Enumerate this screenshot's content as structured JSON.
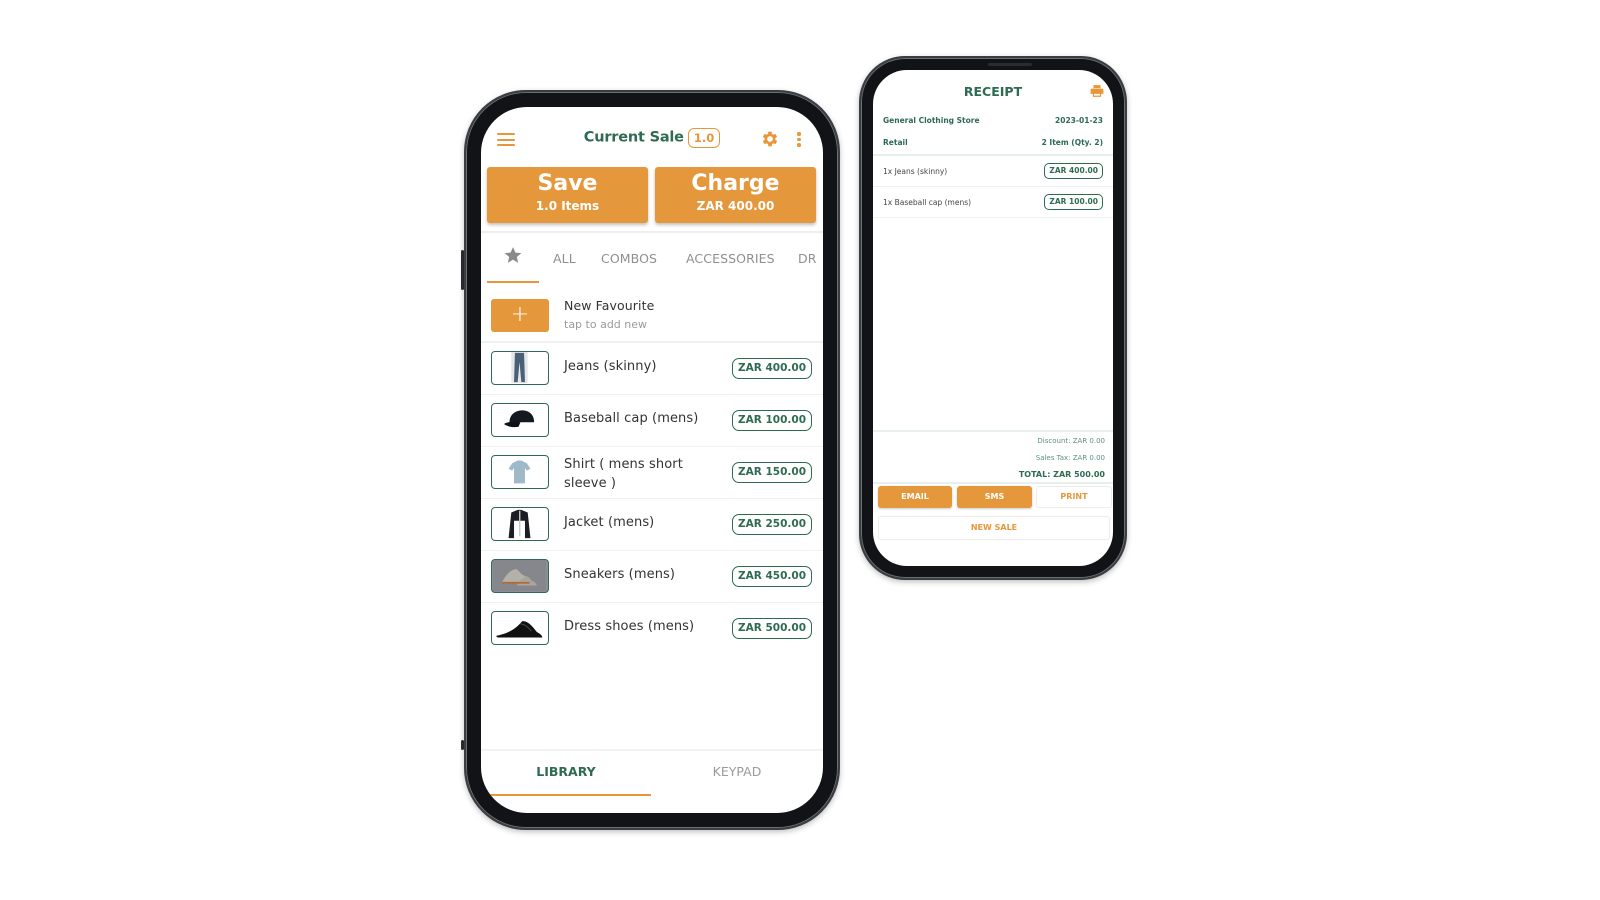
{
  "colors": {
    "accent": "#e5973b",
    "brand_green": "#2e6b52",
    "muted_text": "#8f8f8f"
  },
  "sale_screen": {
    "header": {
      "title": "Current Sale",
      "count_badge": "1.0",
      "menu_icon": "hamburger-icon",
      "settings_icon": "gear-icon",
      "more_icon": "more-vertical-icon"
    },
    "save_button": {
      "label": "Save",
      "sublabel": "1.0 Items"
    },
    "charge_button": {
      "label": "Charge",
      "sublabel": "ZAR 400.00"
    },
    "category_tabs": {
      "favourites_icon": "star-icon",
      "items": [
        "ALL",
        "COMBOS",
        "ACCESSORIES",
        "DR"
      ]
    },
    "new_favourite": {
      "label": "New Favourite",
      "sublabel": "tap to add new",
      "icon": "plus-icon"
    },
    "products": [
      {
        "name": "Jeans (skinny)",
        "price": "ZAR 400.00",
        "thumb": "jeans-image"
      },
      {
        "name": "Baseball cap (mens)",
        "price": "ZAR 100.00",
        "thumb": "cap-image"
      },
      {
        "name": "Shirt ( mens short sleeve )",
        "price": "ZAR 150.00",
        "thumb": "shirt-image"
      },
      {
        "name": "Jacket (mens)",
        "price": "ZAR 250.00",
        "thumb": "jacket-image"
      },
      {
        "name": "Sneakers (mens)",
        "price": "ZAR 450.00",
        "thumb": "sneakers-image"
      },
      {
        "name": "Dress shoes (mens)",
        "price": "ZAR 500.00",
        "thumb": "dress-shoes-image"
      }
    ],
    "bottom_tabs": {
      "library": "LIBRARY",
      "keypad": "KEYPAD",
      "active": "LIBRARY"
    }
  },
  "receipt_screen": {
    "title": "RECEIPT",
    "print_icon": "printer-icon",
    "store_name": "General Clothing Store",
    "date": "2023-01-23",
    "type": "Retail",
    "item_summary": "2 Item (Qty. 2)",
    "lines": [
      {
        "label": "1x Jeans (skinny)",
        "price": "ZAR 400.00"
      },
      {
        "label": "1x Baseball cap (mens)",
        "price": "ZAR 100.00"
      }
    ],
    "discount": "Discount: ZAR 0.00",
    "sales_tax": "Sales Tax: ZAR 0.00",
    "total": "TOTAL: ZAR 500.00",
    "buttons": {
      "email": "EMAIL",
      "sms": "SMS",
      "print": "PRINT",
      "new_sale": "NEW SALE"
    }
  }
}
